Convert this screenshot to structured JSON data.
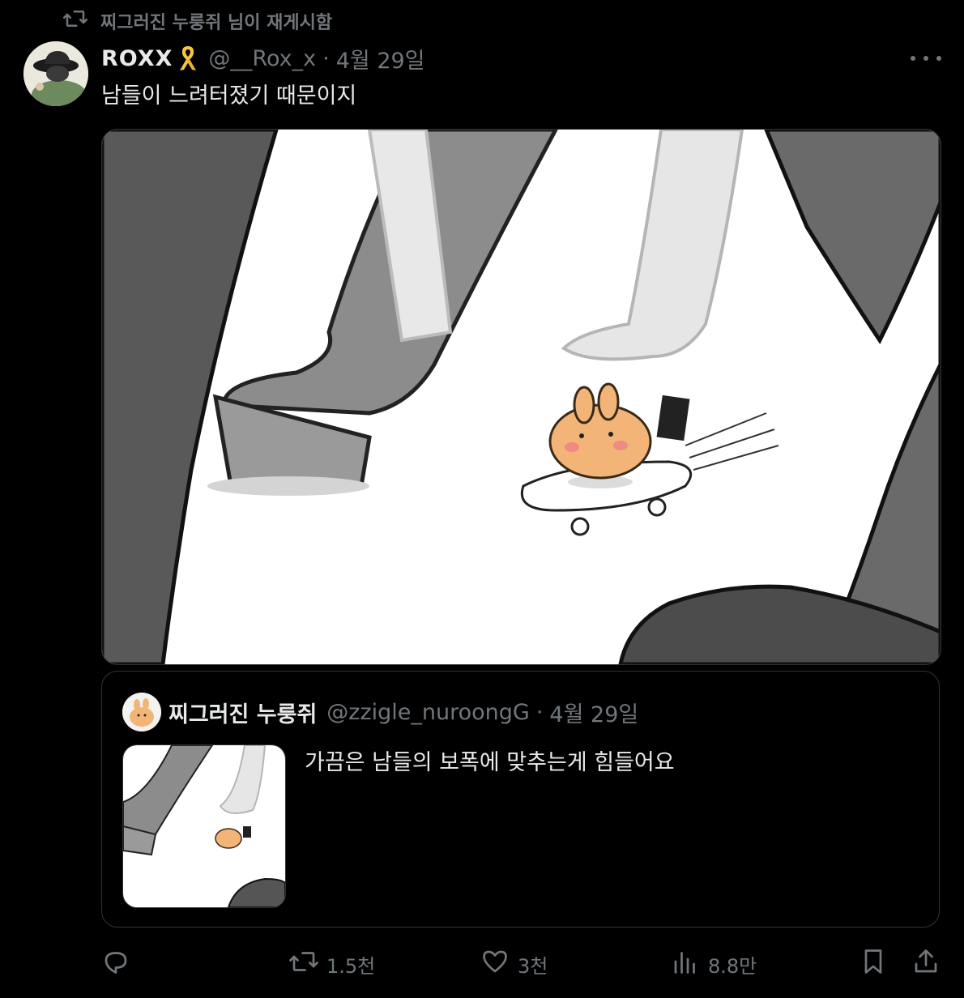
{
  "repost_context": {
    "text": "찌그러진 누룽쥐 님이 재게시함",
    "icon": "repost-icon"
  },
  "tweet": {
    "author_name": "ROXX",
    "badge_icon": "yellow-ribbon-icon",
    "handle": "@__Rox_x",
    "separator": "·",
    "date": "4월 29일",
    "text": "남들이 느려터졌기 때문이지",
    "media_description": "cartoon panel: hamster riding a skateboard between walking legs"
  },
  "quoted_tweet": {
    "author_name": "찌그러진 누룽쥐",
    "handle": "@zzigle_nuroongG",
    "separator": "·",
    "date": "4월 29일",
    "text": "가끔은 남들의 보폭에 맞추는게 힘들어요"
  },
  "actions": {
    "reply": {
      "icon": "reply-icon",
      "count": ""
    },
    "repost": {
      "icon": "repost-icon",
      "count": "1.5천"
    },
    "like": {
      "icon": "heart-icon",
      "count": "3천"
    },
    "views": {
      "icon": "views-icon",
      "count": "8.8만"
    },
    "bookmark": {
      "icon": "bookmark-icon"
    },
    "share": {
      "icon": "share-icon"
    }
  },
  "colors": {
    "background": "#000000",
    "text": "#e7e9ea",
    "muted": "#71767b",
    "border": "#2f3336",
    "ribbon": "#f5c542"
  }
}
